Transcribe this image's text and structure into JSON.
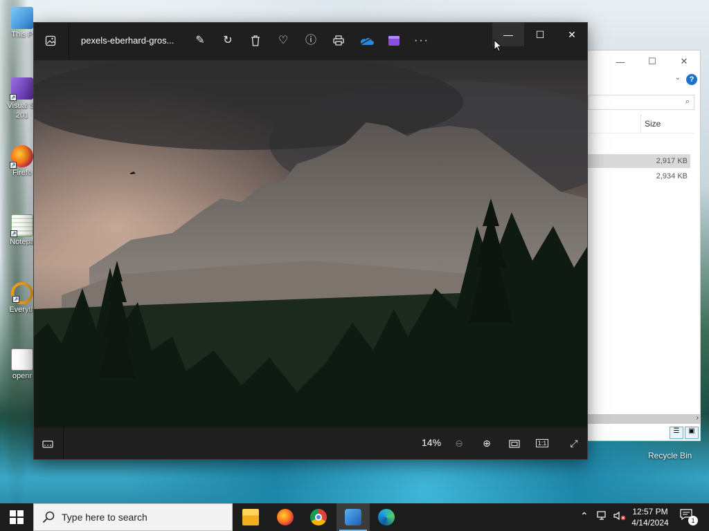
{
  "desktop": {
    "icons": [
      {
        "label": "This P",
        "name": "desktop-icon-this-pc"
      },
      {
        "label": "Visual St 201",
        "name": "desktop-icon-visual-studio"
      },
      {
        "label": "Firefo",
        "name": "desktop-icon-firefox"
      },
      {
        "label": "Notepa",
        "name": "desktop-icon-notepad"
      },
      {
        "label": "Everyth",
        "name": "desktop-icon-everything"
      },
      {
        "label": "openr",
        "name": "desktop-icon-openr"
      }
    ],
    "recycle_bin": "Recycle Bin"
  },
  "explorer": {
    "size_header": "Size",
    "rows": [
      {
        "size": "2,917 KB",
        "selected": true
      },
      {
        "size": "2,934 KB",
        "selected": false
      }
    ]
  },
  "photos": {
    "title": "pexels-eberhard-gros...",
    "toolbar": [
      "edit-icon",
      "rotate-icon",
      "delete-icon",
      "heart-icon",
      "info-icon",
      "print-icon",
      "onedrive-icon",
      "clipchamp-icon",
      "more-icon"
    ],
    "zoom_level": "14%",
    "fit_label": "1:1"
  },
  "taskbar": {
    "search_placeholder": "Type here to search",
    "time": "12:57 PM",
    "date": "4/14/2024",
    "notification_count": "1"
  }
}
